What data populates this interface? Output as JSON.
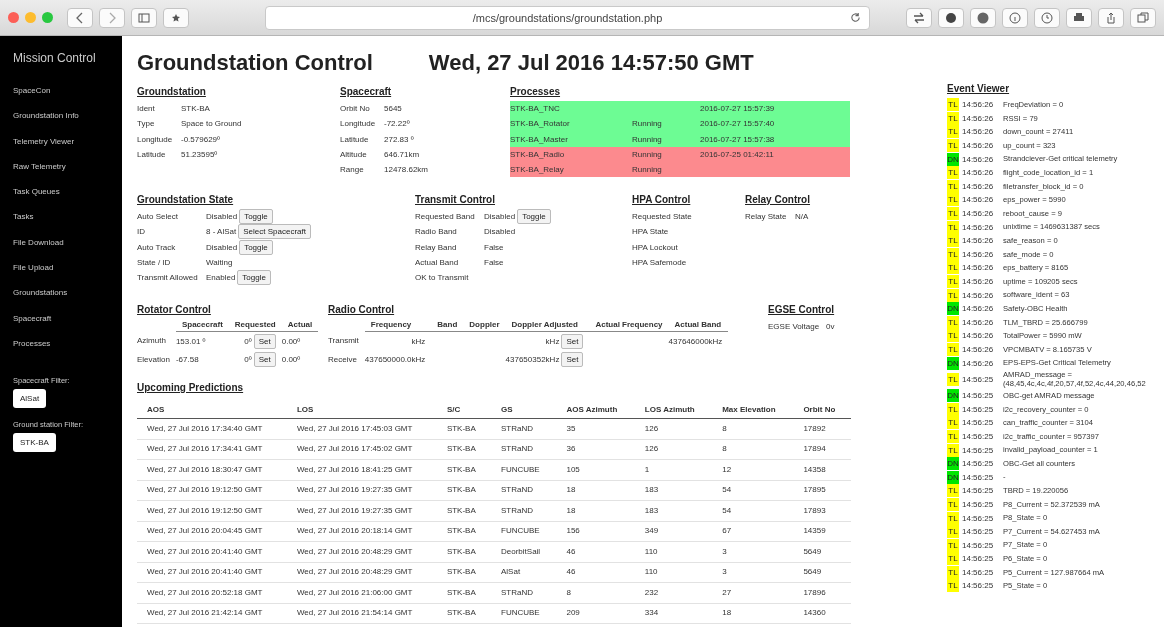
{
  "browser": {
    "url": "/mcs/groundstations/groundstation.php"
  },
  "sidebar": {
    "title": "Mission Control",
    "items": [
      "SpaceCon",
      "Groundstation Info",
      "Telemetry Viewer",
      "Raw Telemetry",
      "Task Queues",
      "Tasks",
      "File Download",
      "File Upload",
      "Groundstations",
      "Spacecraft",
      "Processes"
    ],
    "filters": [
      {
        "label": "Spacecraft Filter:",
        "button": "AlSat"
      },
      {
        "label": "Ground station Filter:",
        "button": "STK-BA"
      }
    ]
  },
  "header": {
    "title": "Groundstation Control",
    "datetime": "Wed, 27 Jul 2016 14:57:50 GMT"
  },
  "groundstation": {
    "title": "Groundstation",
    "rows": [
      {
        "label": "Ident",
        "value": "STK-BA"
      },
      {
        "label": "Type",
        "value": "Space to Ground"
      },
      {
        "label": "Longitude",
        "value": "-0.579629º"
      },
      {
        "label": "Latitude",
        "value": "51.23595º"
      }
    ]
  },
  "spacecraft": {
    "title": "Spacecraft",
    "rows": [
      {
        "label": "Orbit No",
        "value": "5645"
      },
      {
        "label": "Longitude",
        "value": "-72.22º"
      },
      {
        "label": "Latitude",
        "value": "272.83 º"
      },
      {
        "label": "Altitude",
        "value": "646.71km"
      },
      {
        "label": "Range",
        "value": "12478.62km"
      }
    ]
  },
  "processes": {
    "title": "Processes",
    "rows": [
      {
        "name": "STK-BA_TNC",
        "time": "2016-07-27 15:57:39",
        "color": "#6dfc94"
      },
      {
        "name": "STK-BA_Rotator",
        "status": "Running",
        "time": "2016-07-27 15:57:40",
        "color": "#6dfc94"
      },
      {
        "name": "STK-BA_Master",
        "status": "Running",
        "time": "2016-07-27 15:57:38",
        "color": "#6dfc94"
      },
      {
        "name": "STK-BA_Radio",
        "status": "Running",
        "time": "2016-07-25 01:42:11",
        "color": "#fc8a8e"
      },
      {
        "name": "STK-BA_Relay",
        "status": "Running",
        "color": "#fc8a8e"
      }
    ]
  },
  "groundstation_state": {
    "title": "Groundstation State",
    "rows": [
      {
        "label": "Auto Select",
        "value": "Disabled",
        "button": "Toggle"
      },
      {
        "label": "ID",
        "value": "8 - AlSat",
        "button": "Select Spacecraft"
      },
      {
        "label": "Auto Track",
        "value": "Disabled",
        "button": "Toggle"
      },
      {
        "label": "State / ID",
        "value": "Waiting"
      },
      {
        "label": "Transmit Allowed",
        "value": "Enabled",
        "button": "Toggle"
      }
    ]
  },
  "transmit_control": {
    "title": "Transmit Control",
    "rows": [
      {
        "label": "Requested Band",
        "value": "Disabled",
        "button": "Toggle"
      },
      {
        "label": "Radio Band",
        "value": "Disabled"
      },
      {
        "label": "Relay Band",
        "value": "False"
      },
      {
        "label": "Actual Band",
        "value": "False"
      },
      {
        "label": "OK to Transmit"
      }
    ]
  },
  "hpa_control": {
    "title": "HPA Control",
    "rows": [
      {
        "label": "Requested State"
      },
      {
        "label": "HPA State"
      },
      {
        "label": "HPA Lockout"
      },
      {
        "label": "HPA Safemode"
      }
    ]
  },
  "relay_control": {
    "title": "Relay Control",
    "rows": [
      {
        "label": "Relay State",
        "value": "N/A"
      }
    ]
  },
  "rotator_control": {
    "title": "Rotator Control",
    "columns": [
      "Spacecraft",
      "Requested",
      "Actual"
    ],
    "rows": [
      {
        "label": "Azimuth",
        "spacecraft": "153.01 º",
        "requested": "0º",
        "button": "Set",
        "actual": "0.00º"
      },
      {
        "label": "Elevation",
        "spacecraft": "-67.58",
        "requested": "0º",
        "button": "Set",
        "actual": "0.00º"
      }
    ]
  },
  "radio_control": {
    "title": "Radio Control",
    "columns": [
      "Frequency",
      "Band",
      "Doppler",
      "Doppler Adjusted",
      "Actual Frequency",
      "Actual Band"
    ],
    "rows": [
      {
        "label": "Transmit",
        "frequency": "kHz",
        "doppler_adjusted": "kHz",
        "button": "Set",
        "actual_band": "437646000kHz"
      },
      {
        "label": "Receive",
        "frequency": "437650000.0kHz",
        "doppler_adjusted": "437650352kHz",
        "button": "Set"
      }
    ]
  },
  "egse_control": {
    "title": "EGSE Control",
    "rows": [
      {
        "label": "EGSE Voltage",
        "value": "0v"
      }
    ]
  },
  "predictions": {
    "title": "Upcoming Predictions",
    "columns": [
      "AOS",
      "LOS",
      "S/C",
      "GS",
      "AOS Azimuth",
      "LOS Azimuth",
      "Max Elevation",
      "Orbit No"
    ],
    "rows": [
      [
        "Wed, 27 Jul 2016 17:34:40 GMT",
        "Wed, 27 Jul 2016 17:45:03 GMT",
        "STK-BA",
        "STRaND",
        "35",
        "126",
        "8",
        "17892"
      ],
      [
        "Wed, 27 Jul 2016 17:34:41 GMT",
        "Wed, 27 Jul 2016 17:45:02 GMT",
        "STK-BA",
        "STRaND",
        "36",
        "126",
        "8",
        "17894"
      ],
      [
        "Wed, 27 Jul 2016 18:30:47 GMT",
        "Wed, 27 Jul 2016 18:41:25 GMT",
        "STK-BA",
        "FUNCUBE",
        "105",
        "1",
        "12",
        "14358"
      ],
      [
        "Wed, 27 Jul 2016 19:12:50 GMT",
        "Wed, 27 Jul 2016 19:27:35 GMT",
        "STK-BA",
        "STRaND",
        "18",
        "183",
        "54",
        "17895"
      ],
      [
        "Wed, 27 Jul 2016 19:12:50 GMT",
        "Wed, 27 Jul 2016 19:27:35 GMT",
        "STK-BA",
        "STRaND",
        "18",
        "183",
        "54",
        "17893"
      ],
      [
        "Wed, 27 Jul 2016 20:04:45 GMT",
        "Wed, 27 Jul 2016 20:18:14 GMT",
        "STK-BA",
        "FUNCUBE",
        "156",
        "349",
        "67",
        "14359"
      ],
      [
        "Wed, 27 Jul 2016 20:41:40 GMT",
        "Wed, 27 Jul 2016 20:48:29 GMT",
        "STK-BA",
        "DeorbitSail",
        "46",
        "110",
        "3",
        "5649"
      ],
      [
        "Wed, 27 Jul 2016 20:41:40 GMT",
        "Wed, 27 Jul 2016 20:48:29 GMT",
        "STK-BA",
        "AlSat",
        "46",
        "110",
        "3",
        "5649"
      ],
      [
        "Wed, 27 Jul 2016 20:52:18 GMT",
        "Wed, 27 Jul 2016 21:06:00 GMT",
        "STK-BA",
        "STRaND",
        "8",
        "232",
        "27",
        "17896"
      ],
      [
        "Wed, 27 Jul 2016 21:42:14 GMT",
        "Wed, 27 Jul 2016 21:54:14 GMT",
        "STK-BA",
        "FUNCUBE",
        "209",
        "334",
        "18",
        "14360"
      ]
    ]
  },
  "event_viewer": {
    "title": "Event Viewer",
    "events": [
      {
        "tag": "TL",
        "color": "#ffff00",
        "time": "14:56:26",
        "text": "FreqDeviation = 0"
      },
      {
        "tag": "TL",
        "color": "#ffff00",
        "time": "14:56:26",
        "text": "RSSI = 79"
      },
      {
        "tag": "TL",
        "color": "#ffff00",
        "time": "14:56:26",
        "text": "down_count = 27411"
      },
      {
        "tag": "TL",
        "color": "#ffff00",
        "time": "14:56:26",
        "text": "up_count = 323"
      },
      {
        "tag": "DN",
        "color": "#00e600",
        "time": "14:56:26",
        "text": "Strandciever-Get critical telemetry"
      },
      {
        "tag": "TL",
        "color": "#ffff00",
        "time": "14:56:26",
        "text": "flight_code_location_id = 1"
      },
      {
        "tag": "TL",
        "color": "#ffff00",
        "time": "14:56:26",
        "text": "filetransfer_block_id = 0"
      },
      {
        "tag": "TL",
        "color": "#ffff00",
        "time": "14:56:26",
        "text": "eps_power = 5990"
      },
      {
        "tag": "TL",
        "color": "#ffff00",
        "time": "14:56:26",
        "text": "reboot_cause = 9"
      },
      {
        "tag": "TL",
        "color": "#ffff00",
        "time": "14:56:26",
        "text": "unixtime = 1469631387 secs"
      },
      {
        "tag": "TL",
        "color": "#ffff00",
        "time": "14:56:26",
        "text": "safe_reason = 0"
      },
      {
        "tag": "TL",
        "color": "#ffff00",
        "time": "14:56:26",
        "text": "safe_mode = 0"
      },
      {
        "tag": "TL",
        "color": "#ffff00",
        "time": "14:56:26",
        "text": "eps_battery = 8165"
      },
      {
        "tag": "TL",
        "color": "#ffff00",
        "time": "14:56:26",
        "text": "uptime = 109205 secs"
      },
      {
        "tag": "TL",
        "color": "#ffff00",
        "time": "14:56:26",
        "text": "software_ident = 63"
      },
      {
        "tag": "DN",
        "color": "#00e600",
        "time": "14:56:26",
        "text": "Safety-OBC Health"
      },
      {
        "tag": "TL",
        "color": "#ffff00",
        "time": "14:56:26",
        "text": "TLM_TBRD = 25.666799"
      },
      {
        "tag": "TL",
        "color": "#ffff00",
        "time": "14:56:26",
        "text": "TotalPower = 5990 mW"
      },
      {
        "tag": "TL",
        "color": "#ffff00",
        "time": "14:56:26",
        "text": "VPCMBATV = 8.165735 V"
      },
      {
        "tag": "DN",
        "color": "#00e600",
        "time": "14:56:26",
        "text": "EPS-EPS-Get Critical Telemetry"
      },
      {
        "tag": "TL",
        "color": "#ffff00",
        "time": "14:56:25",
        "text": "AMRAD_message = (48,45,4c,4c,4f,20,57,4f,52,4c,44,20,46,52"
      },
      {
        "tag": "DN",
        "color": "#00e600",
        "time": "14:56:25",
        "text": "OBC-get AMRAD message"
      },
      {
        "tag": "TL",
        "color": "#ffff00",
        "time": "14:56:25",
        "text": "i2c_recovery_counter = 0"
      },
      {
        "tag": "TL",
        "color": "#ffff00",
        "time": "14:56:25",
        "text": "can_traffic_counter = 3104"
      },
      {
        "tag": "TL",
        "color": "#ffff00",
        "time": "14:56:25",
        "text": "i2c_traffic_counter = 957397"
      },
      {
        "tag": "TL",
        "color": "#ffff00",
        "time": "14:56:25",
        "text": "invalid_payload_counter = 1"
      },
      {
        "tag": "DN",
        "color": "#00e600",
        "time": "14:56:25",
        "text": "OBC-Get all counters"
      },
      {
        "tag": "DN",
        "color": "#00e600",
        "time": "14:56:25",
        "text": "-"
      },
      {
        "tag": "TL",
        "color": "#ffff00",
        "time": "14:56:25",
        "text": "TBRD = 19.220056"
      },
      {
        "tag": "TL",
        "color": "#ffff00",
        "time": "14:56:25",
        "text": "P8_Current = 52.372539 mA"
      },
      {
        "tag": "TL",
        "color": "#ffff00",
        "time": "14:56:25",
        "text": "P8_State = 0"
      },
      {
        "tag": "TL",
        "color": "#ffff00",
        "time": "14:56:25",
        "text": "P7_Current = 54.627453 mA"
      },
      {
        "tag": "TL",
        "color": "#ffff00",
        "time": "14:56:25",
        "text": "P7_State = 0"
      },
      {
        "tag": "TL",
        "color": "#ffff00",
        "time": "14:56:25",
        "text": "P6_State = 0"
      },
      {
        "tag": "TL",
        "color": "#ffff00",
        "time": "14:56:25",
        "text": "P5_Current = 127.987664 mA"
      },
      {
        "tag": "TL",
        "color": "#ffff00",
        "time": "14:56:25",
        "text": "P5_State = 0"
      }
    ]
  }
}
